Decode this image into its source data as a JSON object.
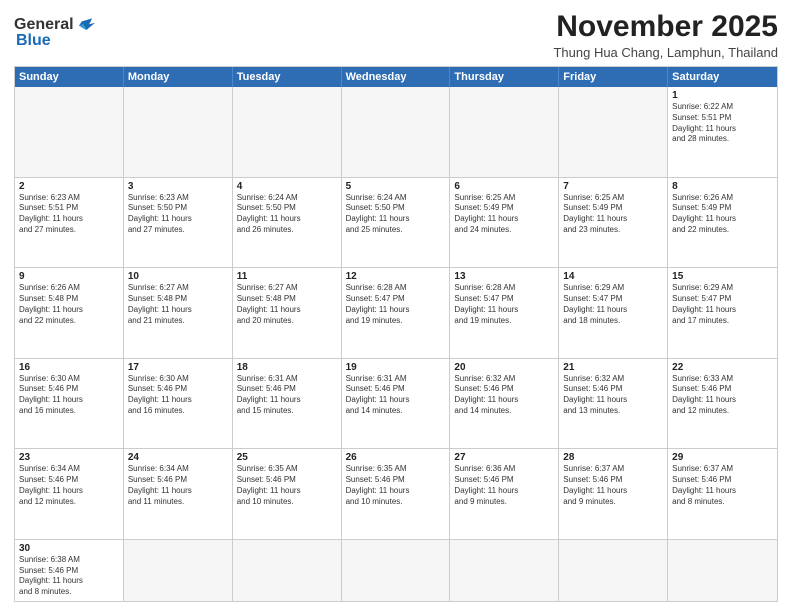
{
  "header": {
    "logo_general": "General",
    "logo_blue": "Blue",
    "month_title": "November 2025",
    "location": "Thung Hua Chang, Lamphun, Thailand"
  },
  "weekdays": [
    "Sunday",
    "Monday",
    "Tuesday",
    "Wednesday",
    "Thursday",
    "Friday",
    "Saturday"
  ],
  "rows": [
    {
      "cells": [
        {
          "day": "",
          "text": "",
          "empty": true
        },
        {
          "day": "",
          "text": "",
          "empty": true
        },
        {
          "day": "",
          "text": "",
          "empty": true
        },
        {
          "day": "",
          "text": "",
          "empty": true
        },
        {
          "day": "",
          "text": "",
          "empty": true
        },
        {
          "day": "",
          "text": "",
          "empty": true
        },
        {
          "day": "1",
          "text": "Sunrise: 6:22 AM\nSunset: 5:51 PM\nDaylight: 11 hours\nand 28 minutes.",
          "empty": false
        }
      ]
    },
    {
      "cells": [
        {
          "day": "2",
          "text": "Sunrise: 6:23 AM\nSunset: 5:51 PM\nDaylight: 11 hours\nand 27 minutes.",
          "empty": false
        },
        {
          "day": "3",
          "text": "Sunrise: 6:23 AM\nSunset: 5:50 PM\nDaylight: 11 hours\nand 27 minutes.",
          "empty": false
        },
        {
          "day": "4",
          "text": "Sunrise: 6:24 AM\nSunset: 5:50 PM\nDaylight: 11 hours\nand 26 minutes.",
          "empty": false
        },
        {
          "day": "5",
          "text": "Sunrise: 6:24 AM\nSunset: 5:50 PM\nDaylight: 11 hours\nand 25 minutes.",
          "empty": false
        },
        {
          "day": "6",
          "text": "Sunrise: 6:25 AM\nSunset: 5:49 PM\nDaylight: 11 hours\nand 24 minutes.",
          "empty": false
        },
        {
          "day": "7",
          "text": "Sunrise: 6:25 AM\nSunset: 5:49 PM\nDaylight: 11 hours\nand 23 minutes.",
          "empty": false
        },
        {
          "day": "8",
          "text": "Sunrise: 6:26 AM\nSunset: 5:49 PM\nDaylight: 11 hours\nand 22 minutes.",
          "empty": false
        }
      ]
    },
    {
      "cells": [
        {
          "day": "9",
          "text": "Sunrise: 6:26 AM\nSunset: 5:48 PM\nDaylight: 11 hours\nand 22 minutes.",
          "empty": false
        },
        {
          "day": "10",
          "text": "Sunrise: 6:27 AM\nSunset: 5:48 PM\nDaylight: 11 hours\nand 21 minutes.",
          "empty": false
        },
        {
          "day": "11",
          "text": "Sunrise: 6:27 AM\nSunset: 5:48 PM\nDaylight: 11 hours\nand 20 minutes.",
          "empty": false
        },
        {
          "day": "12",
          "text": "Sunrise: 6:28 AM\nSunset: 5:47 PM\nDaylight: 11 hours\nand 19 minutes.",
          "empty": false
        },
        {
          "day": "13",
          "text": "Sunrise: 6:28 AM\nSunset: 5:47 PM\nDaylight: 11 hours\nand 19 minutes.",
          "empty": false
        },
        {
          "day": "14",
          "text": "Sunrise: 6:29 AM\nSunset: 5:47 PM\nDaylight: 11 hours\nand 18 minutes.",
          "empty": false
        },
        {
          "day": "15",
          "text": "Sunrise: 6:29 AM\nSunset: 5:47 PM\nDaylight: 11 hours\nand 17 minutes.",
          "empty": false
        }
      ]
    },
    {
      "cells": [
        {
          "day": "16",
          "text": "Sunrise: 6:30 AM\nSunset: 5:46 PM\nDaylight: 11 hours\nand 16 minutes.",
          "empty": false
        },
        {
          "day": "17",
          "text": "Sunrise: 6:30 AM\nSunset: 5:46 PM\nDaylight: 11 hours\nand 16 minutes.",
          "empty": false
        },
        {
          "day": "18",
          "text": "Sunrise: 6:31 AM\nSunset: 5:46 PM\nDaylight: 11 hours\nand 15 minutes.",
          "empty": false
        },
        {
          "day": "19",
          "text": "Sunrise: 6:31 AM\nSunset: 5:46 PM\nDaylight: 11 hours\nand 14 minutes.",
          "empty": false
        },
        {
          "day": "20",
          "text": "Sunrise: 6:32 AM\nSunset: 5:46 PM\nDaylight: 11 hours\nand 14 minutes.",
          "empty": false
        },
        {
          "day": "21",
          "text": "Sunrise: 6:32 AM\nSunset: 5:46 PM\nDaylight: 11 hours\nand 13 minutes.",
          "empty": false
        },
        {
          "day": "22",
          "text": "Sunrise: 6:33 AM\nSunset: 5:46 PM\nDaylight: 11 hours\nand 12 minutes.",
          "empty": false
        }
      ]
    },
    {
      "cells": [
        {
          "day": "23",
          "text": "Sunrise: 6:34 AM\nSunset: 5:46 PM\nDaylight: 11 hours\nand 12 minutes.",
          "empty": false
        },
        {
          "day": "24",
          "text": "Sunrise: 6:34 AM\nSunset: 5:46 PM\nDaylight: 11 hours\nand 11 minutes.",
          "empty": false
        },
        {
          "day": "25",
          "text": "Sunrise: 6:35 AM\nSunset: 5:46 PM\nDaylight: 11 hours\nand 10 minutes.",
          "empty": false
        },
        {
          "day": "26",
          "text": "Sunrise: 6:35 AM\nSunset: 5:46 PM\nDaylight: 11 hours\nand 10 minutes.",
          "empty": false
        },
        {
          "day": "27",
          "text": "Sunrise: 6:36 AM\nSunset: 5:46 PM\nDaylight: 11 hours\nand 9 minutes.",
          "empty": false
        },
        {
          "day": "28",
          "text": "Sunrise: 6:37 AM\nSunset: 5:46 PM\nDaylight: 11 hours\nand 9 minutes.",
          "empty": false
        },
        {
          "day": "29",
          "text": "Sunrise: 6:37 AM\nSunset: 5:46 PM\nDaylight: 11 hours\nand 8 minutes.",
          "empty": false
        }
      ]
    }
  ],
  "last_row": {
    "day": "30",
    "text": "Sunrise: 6:38 AM\nSunset: 5:46 PM\nDaylight: 11 hours\nand 8 minutes."
  }
}
